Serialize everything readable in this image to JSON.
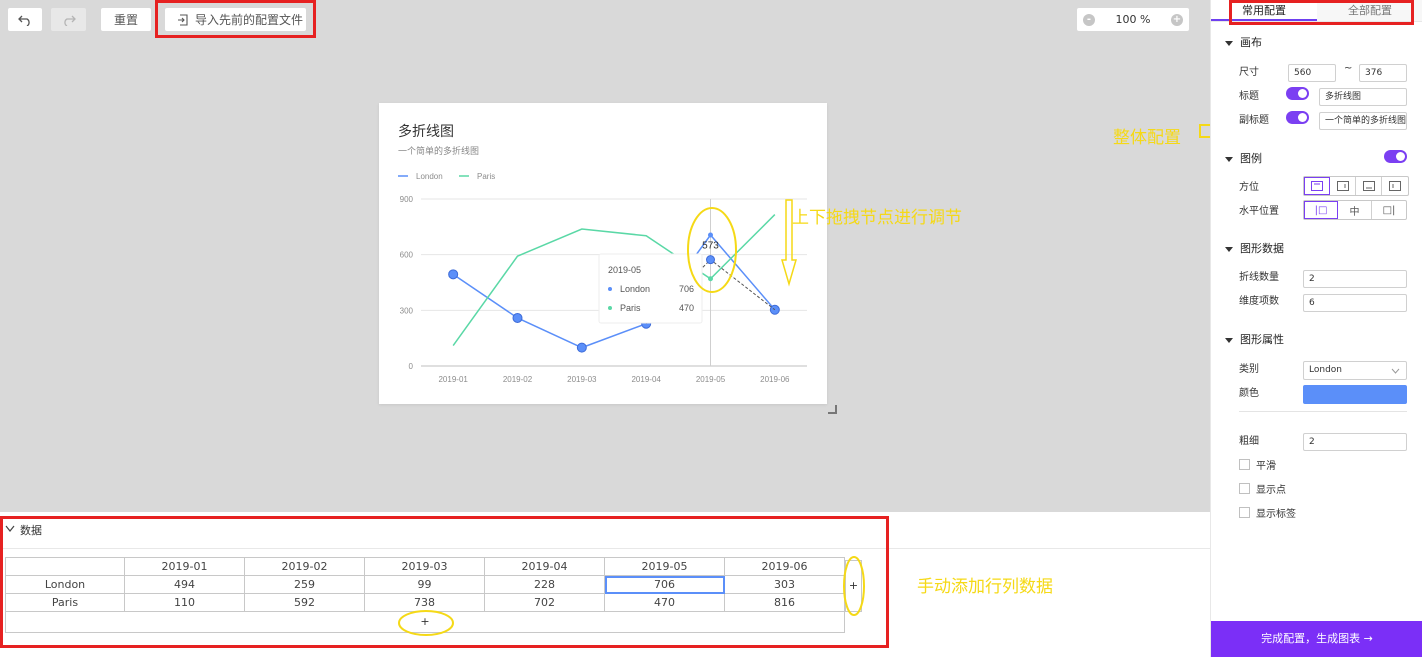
{
  "toolbar": {
    "reset_label": "重置",
    "import_label": "导入先前的配置文件",
    "zoom_text": "100 %",
    "zoom_out": "-",
    "zoom_in": "+"
  },
  "chart": {
    "title": "多折线图",
    "subtitle": "一个简单的多折线图",
    "tooltip": {
      "title": "2019-05",
      "rows": [
        {
          "name": "London",
          "value": "706"
        },
        {
          "name": "Paris",
          "value": "470"
        }
      ],
      "drag_value": "573"
    }
  },
  "chart_data": {
    "type": "line",
    "title": "多折线图",
    "subtitle": "一个简单的多折线图",
    "categories": [
      "2019-01",
      "2019-02",
      "2019-03",
      "2019-04",
      "2019-05",
      "2019-06"
    ],
    "series": [
      {
        "name": "London",
        "values": [
          494,
          259,
          99,
          228,
          706,
          303
        ],
        "color": "#5b8ff9"
      },
      {
        "name": "Paris",
        "values": [
          110,
          592,
          738,
          702,
          470,
          816
        ],
        "color": "#5ad8a6"
      }
    ],
    "yticks": [
      "0",
      "300",
      "600",
      "900"
    ],
    "ylim": [
      0,
      900
    ],
    "legend_position": "top-left",
    "grid": true
  },
  "annotations": {
    "drag_hint": "上下拖拽节点进行调节",
    "global_config": "整体配置",
    "manual_add": "手动添加行列数据"
  },
  "data_panel": {
    "title": "数据",
    "headers": [
      "",
      "2019-01",
      "2019-02",
      "2019-03",
      "2019-04",
      "2019-05",
      "2019-06"
    ],
    "rows": [
      [
        "London",
        "494",
        "259",
        "99",
        "228",
        "706",
        "303"
      ],
      [
        "Paris",
        "110",
        "592",
        "738",
        "702",
        "470",
        "816"
      ]
    ],
    "add_col": "+",
    "add_row": "+"
  },
  "sidebar": {
    "tabs": [
      "常用配置",
      "全部配置"
    ],
    "canvas": {
      "title": "画布",
      "size_label": "尺寸",
      "width": "560",
      "tilde": "~",
      "height": "376",
      "title_label": "标题",
      "title_value": "多折线图",
      "subtitle_label": "副标题",
      "subtitle_value": "一个简单的多折线图"
    },
    "legend": {
      "title": "图例",
      "position_label": "方位",
      "align_label": "水平位置",
      "align_options": [
        "|□",
        "中",
        "□|"
      ]
    },
    "data": {
      "title": "图形数据",
      "line_count_label": "折线数量",
      "line_count": "2",
      "dim_label": "维度项数",
      "dim_count": "6"
    },
    "props": {
      "title": "图形属性",
      "category_label": "类别",
      "category_value": "London",
      "color_label": "颜色",
      "color_value": "#5b8ff9",
      "width_label": "粗细",
      "width_value": "2",
      "smooth_label": "平滑",
      "show_point_label": "显示点",
      "show_label_label": "显示标签"
    },
    "finish_label": "完成配置，生成图表 →"
  }
}
